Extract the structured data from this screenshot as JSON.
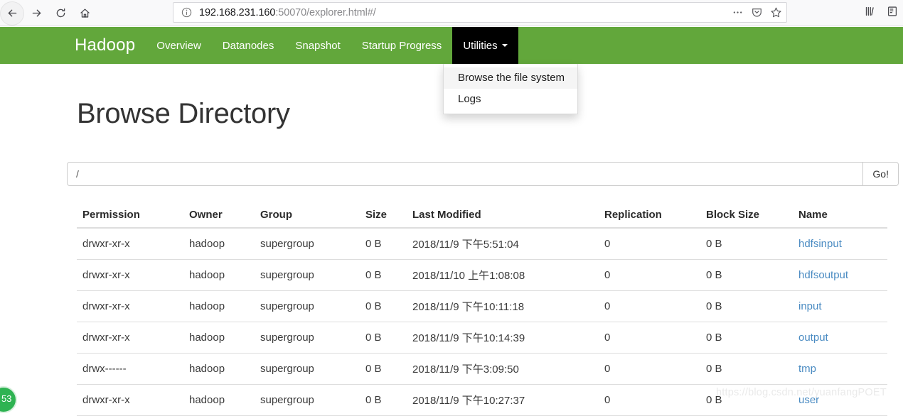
{
  "browser": {
    "back_icon": "back-arrow-icon",
    "forward_icon": "forward-arrow-icon",
    "reload_icon": "reload-icon",
    "home_icon": "home-icon",
    "info_icon": "page-info-icon",
    "url_host": "192.168.231.160",
    "url_rest": ":50070/explorer.html#/",
    "url_full": "192.168.231.160:50070/explorer.html#/",
    "page_actions_icon": "ellipsis-icon",
    "pocket_icon": "pocket-icon",
    "bookmark_icon": "star-icon",
    "library_icon": "library-icon",
    "sidebar_icon": "reader-view-icon"
  },
  "navbar": {
    "brand": "Hadoop",
    "items": [
      {
        "label": "Overview",
        "active": false
      },
      {
        "label": "Datanodes",
        "active": false
      },
      {
        "label": "Snapshot",
        "active": false
      },
      {
        "label": "Startup Progress",
        "active": false
      },
      {
        "label": "Utilities",
        "active": true,
        "has_caret": true
      }
    ],
    "background_color": "#62a73b",
    "active_color": "#000000"
  },
  "dropdown": {
    "open": true,
    "items": [
      {
        "label": "Browse the file system",
        "hovered": true
      },
      {
        "label": "Logs",
        "hovered": false
      }
    ]
  },
  "page": {
    "title": "Browse Directory"
  },
  "path_form": {
    "value": "/",
    "placeholder": "",
    "go_label": "Go!"
  },
  "table": {
    "headers": [
      "Permission",
      "Owner",
      "Group",
      "Size",
      "Last Modified",
      "Replication",
      "Block Size",
      "Name"
    ],
    "rows": [
      {
        "permission": "drwxr-xr-x",
        "owner": "hadoop",
        "group": "supergroup",
        "size": "0 B",
        "last_modified": "2018/11/9 下午5:51:04",
        "replication": "0",
        "block_size": "0 B",
        "name": "hdfsinput"
      },
      {
        "permission": "drwxr-xr-x",
        "owner": "hadoop",
        "group": "supergroup",
        "size": "0 B",
        "last_modified": "2018/11/10 上午1:08:08",
        "replication": "0",
        "block_size": "0 B",
        "name": "hdfsoutput"
      },
      {
        "permission": "drwxr-xr-x",
        "owner": "hadoop",
        "group": "supergroup",
        "size": "0 B",
        "last_modified": "2018/11/9 下午10:11:18",
        "replication": "0",
        "block_size": "0 B",
        "name": "input"
      },
      {
        "permission": "drwxr-xr-x",
        "owner": "hadoop",
        "group": "supergroup",
        "size": "0 B",
        "last_modified": "2018/11/9 下午10:14:39",
        "replication": "0",
        "block_size": "0 B",
        "name": "output"
      },
      {
        "permission": "drwx------",
        "owner": "hadoop",
        "group": "supergroup",
        "size": "0 B",
        "last_modified": "2018/11/9 下午3:09:50",
        "replication": "0",
        "block_size": "0 B",
        "name": "tmp"
      },
      {
        "permission": "drwxr-xr-x",
        "owner": "hadoop",
        "group": "supergroup",
        "size": "0 B",
        "last_modified": "2018/11/9 下午10:27:37",
        "replication": "0",
        "block_size": "0 B",
        "name": "user"
      }
    ]
  },
  "watermark": {
    "text": "https://blog.csdn.net/yuanfangPOET"
  },
  "corner_badge": {
    "text": "53",
    "color": "#2eb352"
  }
}
